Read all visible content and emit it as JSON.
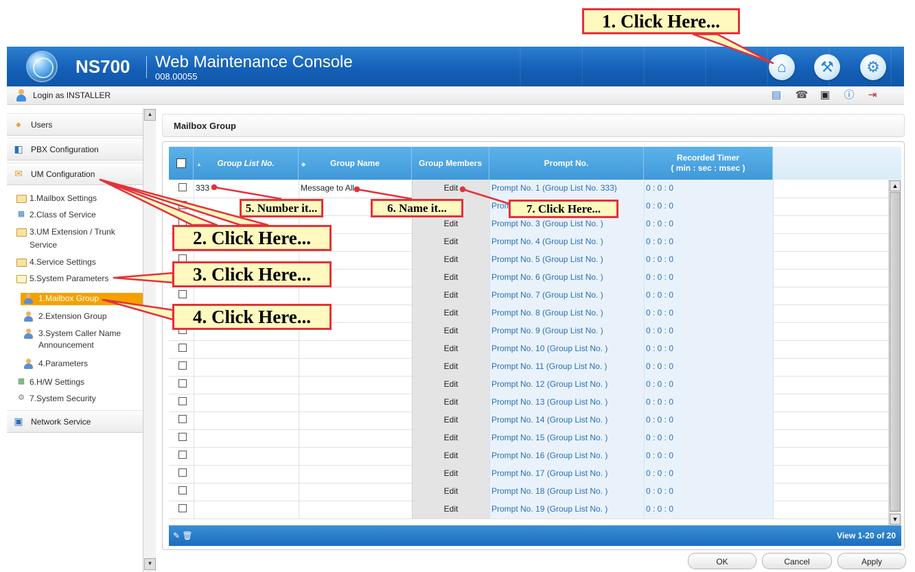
{
  "header": {
    "brand": "NS700",
    "title": "Web Maintenance Console",
    "version": "008.00055"
  },
  "toolbar": {
    "login_text": "Login as INSTALLER"
  },
  "sidebar": {
    "sections": [
      {
        "label": "Users"
      },
      {
        "label": "PBX Configuration"
      },
      {
        "label": "UM Configuration"
      },
      {
        "label": "Network Service"
      }
    ],
    "um_items": [
      "1.Mailbox Settings",
      "2.Class of Service",
      "3.UM Extension / Trunk",
      "Service",
      "4.Service Settings",
      "5.System Parameters",
      "6.H/W Settings",
      "7.System Security"
    ],
    "system_params_sub": [
      "1.Mailbox Group",
      "2.Extension Group",
      "3.System Caller Name",
      "Announcement",
      "4.Parameters"
    ]
  },
  "page": {
    "title": "Mailbox Group"
  },
  "grid": {
    "columns": {
      "group_list_no": "Group List No.",
      "group_name": "Group Name",
      "group_members": "Group Members",
      "prompt_no": "Prompt No.",
      "recorded_timer_line1": "Recorded Timer",
      "recorded_timer_line2": "( min : sec : msec )"
    },
    "rows": [
      {
        "no": "333",
        "name": "Message to All",
        "edit": "Edit",
        "prompt": "Prompt No. 1 (Group List No. 333)",
        "timer": "0 : 0 : 0"
      },
      {
        "no": "",
        "name": "",
        "edit": "Edit",
        "prompt": "Prompt No. 2 (Group List No. )",
        "timer": "0 : 0 : 0"
      },
      {
        "no": "",
        "name": "",
        "edit": "Edit",
        "prompt": "Prompt No. 3 (Group List No. )",
        "timer": "0 : 0 : 0"
      },
      {
        "no": "",
        "name": "",
        "edit": "Edit",
        "prompt": "Prompt No. 4 (Group List No. )",
        "timer": "0 : 0 : 0"
      },
      {
        "no": "",
        "name": "",
        "edit": "Edit",
        "prompt": "Prompt No. 5 (Group List No. )",
        "timer": "0 : 0 : 0"
      },
      {
        "no": "",
        "name": "",
        "edit": "Edit",
        "prompt": "Prompt No. 6 (Group List No. )",
        "timer": "0 : 0 : 0"
      },
      {
        "no": "",
        "name": "",
        "edit": "Edit",
        "prompt": "Prompt No. 7 (Group List No. )",
        "timer": "0 : 0 : 0"
      },
      {
        "no": "",
        "name": "",
        "edit": "Edit",
        "prompt": "Prompt No. 8 (Group List No. )",
        "timer": "0 : 0 : 0"
      },
      {
        "no": "",
        "name": "",
        "edit": "Edit",
        "prompt": "Prompt No. 9 (Group List No. )",
        "timer": "0 : 0 : 0"
      },
      {
        "no": "",
        "name": "",
        "edit": "Edit",
        "prompt": "Prompt No. 10 (Group List No. )",
        "timer": "0 : 0 : 0"
      },
      {
        "no": "",
        "name": "",
        "edit": "Edit",
        "prompt": "Prompt No. 11 (Group List No. )",
        "timer": "0 : 0 : 0"
      },
      {
        "no": "",
        "name": "",
        "edit": "Edit",
        "prompt": "Prompt No. 12 (Group List No. )",
        "timer": "0 : 0 : 0"
      },
      {
        "no": "",
        "name": "",
        "edit": "Edit",
        "prompt": "Prompt No. 13 (Group List No. )",
        "timer": "0 : 0 : 0"
      },
      {
        "no": "",
        "name": "",
        "edit": "Edit",
        "prompt": "Prompt No. 14 (Group List No. )",
        "timer": "0 : 0 : 0"
      },
      {
        "no": "",
        "name": "",
        "edit": "Edit",
        "prompt": "Prompt No. 15 (Group List No. )",
        "timer": "0 : 0 : 0"
      },
      {
        "no": "",
        "name": "",
        "edit": "Edit",
        "prompt": "Prompt No. 16 (Group List No. )",
        "timer": "0 : 0 : 0"
      },
      {
        "no": "",
        "name": "",
        "edit": "Edit",
        "prompt": "Prompt No. 17 (Group List No. )",
        "timer": "0 : 0 : 0"
      },
      {
        "no": "",
        "name": "",
        "edit": "Edit",
        "prompt": "Prompt No. 18 (Group List No. )",
        "timer": "0 : 0 : 0"
      },
      {
        "no": "",
        "name": "",
        "edit": "Edit",
        "prompt": "Prompt No. 19 (Group List No. )",
        "timer": "0 : 0 : 0"
      }
    ],
    "footer_count": "View 1-20 of 20"
  },
  "buttons": {
    "ok": "OK",
    "cancel": "Cancel",
    "apply": "Apply"
  },
  "callouts": {
    "c1": "1. Click Here...",
    "c2": "2. Click Here...",
    "c3": "3. Click Here...",
    "c4": "4. Click Here...",
    "c5": "5. Number it...",
    "c6": "6. Name it...",
    "c7": "7. Click Here..."
  },
  "colors": {
    "header_blue": "#1560b8",
    "grid_header_blue": "#4aa2de",
    "active_orange": "#f4a100",
    "callout_border": "#e6303a",
    "callout_fill": "#fff9bf"
  },
  "icons": {
    "header_buttons": [
      "home-icon",
      "tools-icon",
      "settings-icon"
    ],
    "toolbar": [
      "task-icon",
      "phone-icon",
      "save-icon",
      "info-icon",
      "logout-icon"
    ]
  }
}
